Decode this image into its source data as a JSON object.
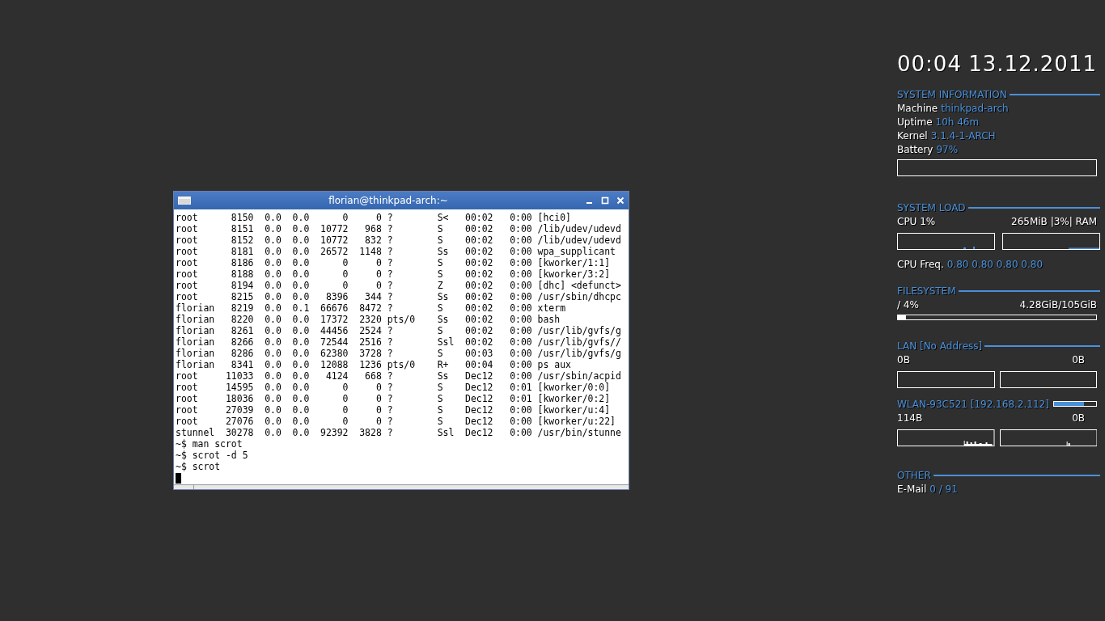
{
  "terminal": {
    "title": "florian@thinkpad-arch:~",
    "lines": [
      "root      8150  0.0  0.0      0     0 ?        S<   00:02   0:00 [hci0]",
      "root      8151  0.0  0.0  10772   968 ?        S    00:02   0:00 /lib/udev/udevd",
      "root      8152  0.0  0.0  10772   832 ?        S    00:02   0:00 /lib/udev/udevd",
      "root      8181  0.0  0.0  26572  1148 ?        Ss   00:02   0:00 wpa_supplicant",
      "root      8186  0.0  0.0      0     0 ?        S    00:02   0:00 [kworker/1:1]",
      "root      8188  0.0  0.0      0     0 ?        S    00:02   0:00 [kworker/3:2]",
      "root      8194  0.0  0.0      0     0 ?        Z    00:02   0:00 [dhc] <defunct>",
      "root      8215  0.0  0.0   8396   344 ?        Ss   00:02   0:00 /usr/sbin/dhcpc",
      "florian   8219  0.0  0.1  66676  8472 ?        S    00:02   0:00 xterm",
      "florian   8220  0.0  0.0  17372  2320 pts/0    Ss   00:02   0:00 bash",
      "florian   8261  0.0  0.0  44456  2524 ?        S    00:02   0:00 /usr/lib/gvfs/g",
      "florian   8266  0.0  0.0  72544  2516 ?        Ssl  00:02   0:00 /usr/lib/gvfs//",
      "florian   8286  0.0  0.0  62380  3728 ?        S    00:03   0:00 /usr/lib/gvfs/g",
      "florian   8341  0.0  0.0  12088  1236 pts/0    R+   00:04   0:00 ps aux",
      "root     11033  0.0  0.0   4124   668 ?        Ss   Dec12   0:00 /usr/sbin/acpid",
      "root     14595  0.0  0.0      0     0 ?        S    Dec12   0:01 [kworker/0:0]",
      "root     18036  0.0  0.0      0     0 ?        S    Dec12   0:01 [kworker/0:2]",
      "root     27039  0.0  0.0      0     0 ?        S    Dec12   0:00 [kworker/u:4]",
      "root     27076  0.0  0.0      0     0 ?        S    Dec12   0:00 [kworker/u:22]",
      "stunnel  30278  0.0  0.0  92392  3828 ?        Ssl  Dec12   0:00 /usr/bin/stunne",
      "~$ man scrot",
      "~$ scrot -d 5",
      "~$ scrot"
    ]
  },
  "conky": {
    "time": "00:04",
    "date": "13.12.2011",
    "system_information": {
      "heading": "SYSTEM INFORMATION",
      "rows": [
        {
          "label": "Machine",
          "value": "thinkpad-arch"
        },
        {
          "label": "Uptime",
          "value": "10h 46m"
        },
        {
          "label": "Kernel",
          "value": "3.1.4-1-ARCH"
        },
        {
          "label": "Battery",
          "value": "97%"
        }
      ]
    },
    "system_load": {
      "heading": "SYSTEM LOAD",
      "cpu": "CPU 1%",
      "ram": "265MiB |3%| RAM",
      "freq_label": "CPU Freq.",
      "freq_values": "0.80 0.80 0.80 0.80"
    },
    "filesystem": {
      "heading": "FILESYSTEM",
      "mount": "/ 4%",
      "usage": "4.28GiB/105GiB",
      "level": 0.04
    },
    "lan": {
      "heading": "LAN [No Address]",
      "down": "0B",
      "up": "0B"
    },
    "wlan": {
      "heading": "WLAN-93C521 [192.168.2.112]",
      "level": 0.72,
      "down": "114B",
      "up": "0B"
    },
    "other": {
      "heading": "OTHER",
      "rows": [
        {
          "label": "E-Mail",
          "value": "0 / 91"
        }
      ]
    }
  }
}
